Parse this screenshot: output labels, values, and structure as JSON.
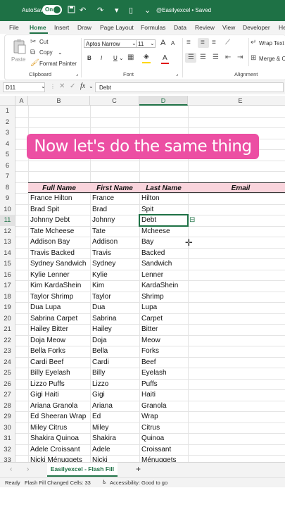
{
  "titlebar": {
    "autosave_label": "AutoSave",
    "toggle_label": "On",
    "document_title": "@Easilyexcel • Saved",
    "undo_icon": "undo-icon",
    "redo_icon": "redo-icon"
  },
  "ribbon_tabs": [
    "File",
    "Home",
    "Insert",
    "Draw",
    "Page Layout",
    "Formulas",
    "Data",
    "Review",
    "View",
    "Developer",
    "He"
  ],
  "active_tab": "Home",
  "ribbon": {
    "paste_label": "Paste",
    "cut_label": "Cut",
    "copy_label": "Copy",
    "format_painter_label": "Format Painter",
    "clipboard_group": "Clipboard",
    "font_name": "Aptos Narrow",
    "font_size": "11",
    "grow_font": "A",
    "shrink_font": "A",
    "bold": "B",
    "italic": "I",
    "underline": "U",
    "font_color_glyph": "A",
    "font_group": "Font",
    "wrap_text_label": "Wrap Text",
    "merge_label": "Merge & Ce",
    "alignment_group": "Alignment"
  },
  "formula_bar": {
    "name_box": "D11",
    "fx": "fx",
    "value": "Debt"
  },
  "columns": [
    "A",
    "B",
    "C",
    "D",
    "E"
  ],
  "rows": [
    "1",
    "2",
    "3",
    "4",
    "5",
    "6",
    "7",
    "8",
    "9",
    "10",
    "11",
    "12",
    "13",
    "14",
    "15",
    "16",
    "17",
    "18",
    "19",
    "20",
    "21",
    "22",
    "23",
    "24",
    "25",
    "26",
    "27",
    "28",
    "29",
    "30",
    "31",
    "32",
    "33"
  ],
  "banner_text": "Now let's do the same thing",
  "table": {
    "headers": [
      "Full Name",
      "First Name",
      "Last Name",
      "Email"
    ],
    "rows": [
      [
        "France Hilton",
        "France",
        "Hilton"
      ],
      [
        "Brad Spit",
        "Brad",
        "Spit"
      ],
      [
        "Johnny Debt",
        "Johnny",
        "Debt"
      ],
      [
        "Tate Mcheese",
        "Tate",
        "Mcheese"
      ],
      [
        "Addison Bay",
        "Addison",
        "Bay"
      ],
      [
        "Travis Backed",
        "Travis",
        "Backed"
      ],
      [
        "Sydney Sandwich",
        "Sydney",
        "Sandwich"
      ],
      [
        "Kylie Lenner",
        "Kylie",
        "Lenner"
      ],
      [
        "Kim KardaShein",
        "Kim",
        "KardaShein"
      ],
      [
        "Taylor Shrimp",
        "Taylor",
        "Shrimp"
      ],
      [
        "Dua Lupa",
        "Dua",
        "Lupa"
      ],
      [
        "Sabrina Carpet",
        "Sabrina",
        "Carpet"
      ],
      [
        "Hailey Bitter",
        "Hailey",
        "Bitter"
      ],
      [
        "Doja Meow",
        "Doja",
        "Meow"
      ],
      [
        "Bella Forks",
        "Bella",
        "Forks"
      ],
      [
        "Cardi Beef",
        "Cardi",
        "Beef"
      ],
      [
        "Billy Eyelash",
        "Billy",
        "Eyelash"
      ],
      [
        "Lizzo Puffs",
        "Lizzo",
        "Puffs"
      ],
      [
        "Gigi Haiti",
        "Gigi",
        "Haiti"
      ],
      [
        "Ariana Granola",
        "Ariana",
        "Granola"
      ],
      [
        "Ed Sheeran Wrap",
        "Ed",
        "Wrap"
      ],
      [
        "Miley Citrus",
        "Miley",
        "Citrus"
      ],
      [
        "Shakira Quinoa",
        "Shakira",
        "Quinoa"
      ],
      [
        "Adele Croissant",
        "Adele",
        "Croissant"
      ],
      [
        "Nicki Ménuggets",
        "Nicki",
        "Ménuggets"
      ]
    ]
  },
  "sheet_tab": "Easilyexcel - Flash Fill",
  "add_sheet": "+",
  "status": {
    "ready": "Ready",
    "flash_fill": "Flash Fill Changed Cells: 33",
    "accessibility": "Accessibility: Good to go"
  },
  "colors": {
    "excel_green": "#1e7145",
    "banner_pink": "#ec4fa3",
    "header_fill": "#f9d4dc"
  }
}
